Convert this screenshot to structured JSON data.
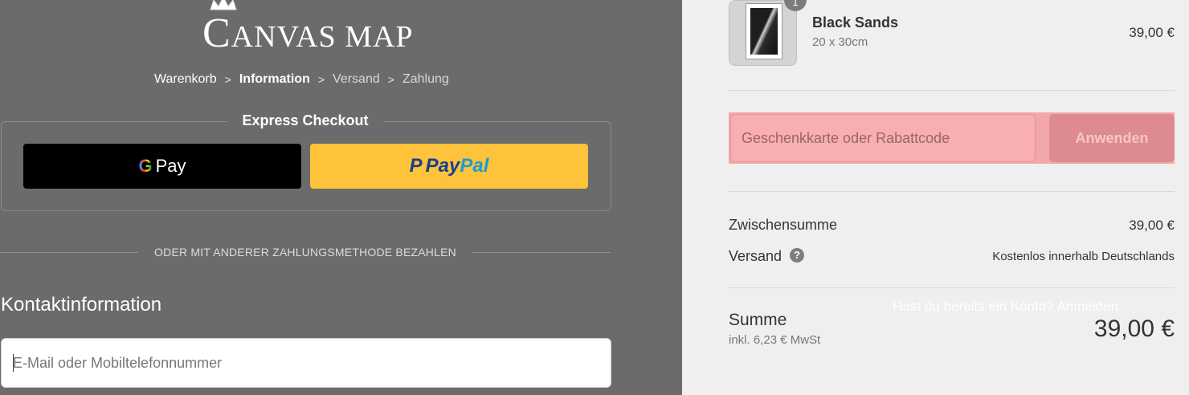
{
  "store": {
    "logo_initial": "C",
    "logo_rest": "ANVAS MAP"
  },
  "breadcrumb": {
    "cart": "Warenkorb",
    "information": "Information",
    "shipping": "Versand",
    "payment": "Zahlung",
    "separator": ">"
  },
  "express": {
    "title": "Express Checkout",
    "gpay_g": "G",
    "gpay_label": "Pay",
    "paypal_pay": "Pay",
    "paypal_pal": "Pal",
    "paypal_icon": "P"
  },
  "divider": "ODER MIT ANDERER ZAHLUNGSMETHODE BEZAHLEN",
  "contact": {
    "title": "Kontaktinformation",
    "login_prompt": "Hast du bereits ein Konto?",
    "login_link": "Anmelden",
    "email_placeholder": "E-Mail oder Mobiltelefonnummer"
  },
  "cart": {
    "quantity": "1",
    "product_name": "Black Sands",
    "variant": "20 x 30cm",
    "price": "39,00 €"
  },
  "discount": {
    "placeholder": "Geschenkkarte oder Rabattcode",
    "apply_label": "Anwenden"
  },
  "summary": {
    "subtotal_label": "Zwischensumme",
    "subtotal_value": "39,00 €",
    "shipping_label": "Versand",
    "shipping_help": "?",
    "shipping_value": "Kostenlos innerhalb Deutschlands",
    "total_label": "Summe",
    "tax_note": "inkl. 6,23 € MwSt",
    "total_value": "39,00 €"
  },
  "colors": {
    "left_bg": "#6b6b6b",
    "right_bg": "#efefef",
    "paypal_yellow": "#fec33a",
    "highlight": "#f4a7ab"
  }
}
